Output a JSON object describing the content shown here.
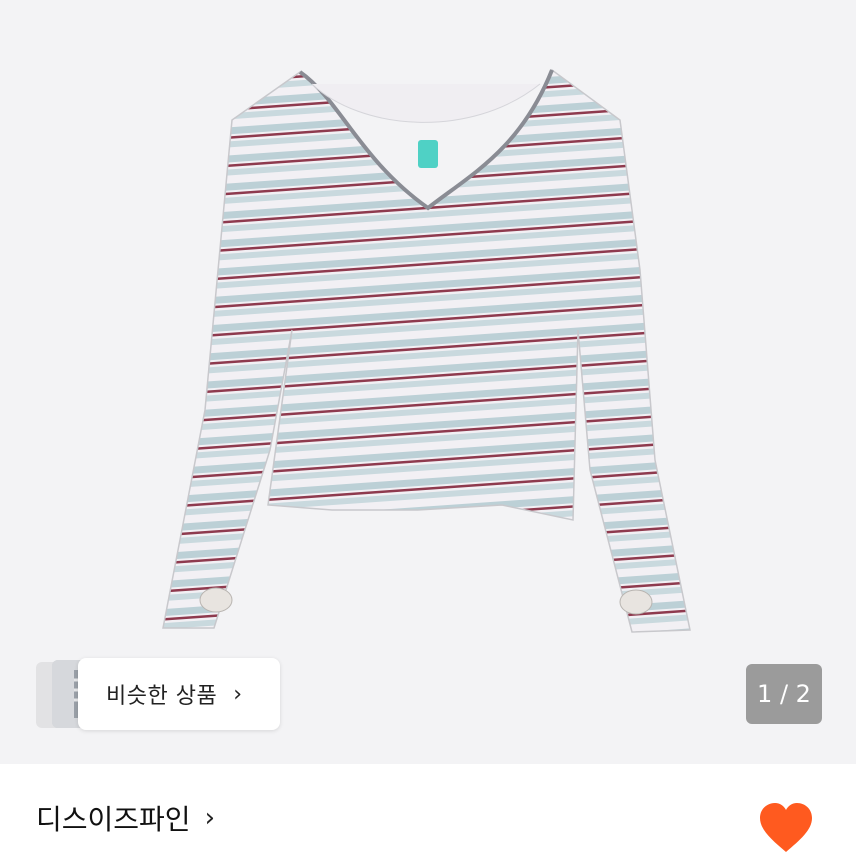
{
  "product_image": {
    "description_icon": "striped-v-neck-long-sleeve-top",
    "background_color": "#f3f3f5"
  },
  "similar_products": {
    "label": "비슷한 상품",
    "chevron": "›"
  },
  "pager": {
    "current": 1,
    "total": 2,
    "text": "1 / 2"
  },
  "shop": {
    "name": "디스이즈파인",
    "chevron": "›"
  },
  "like": {
    "icon": "heart-icon",
    "color": "#ff5a1f"
  }
}
